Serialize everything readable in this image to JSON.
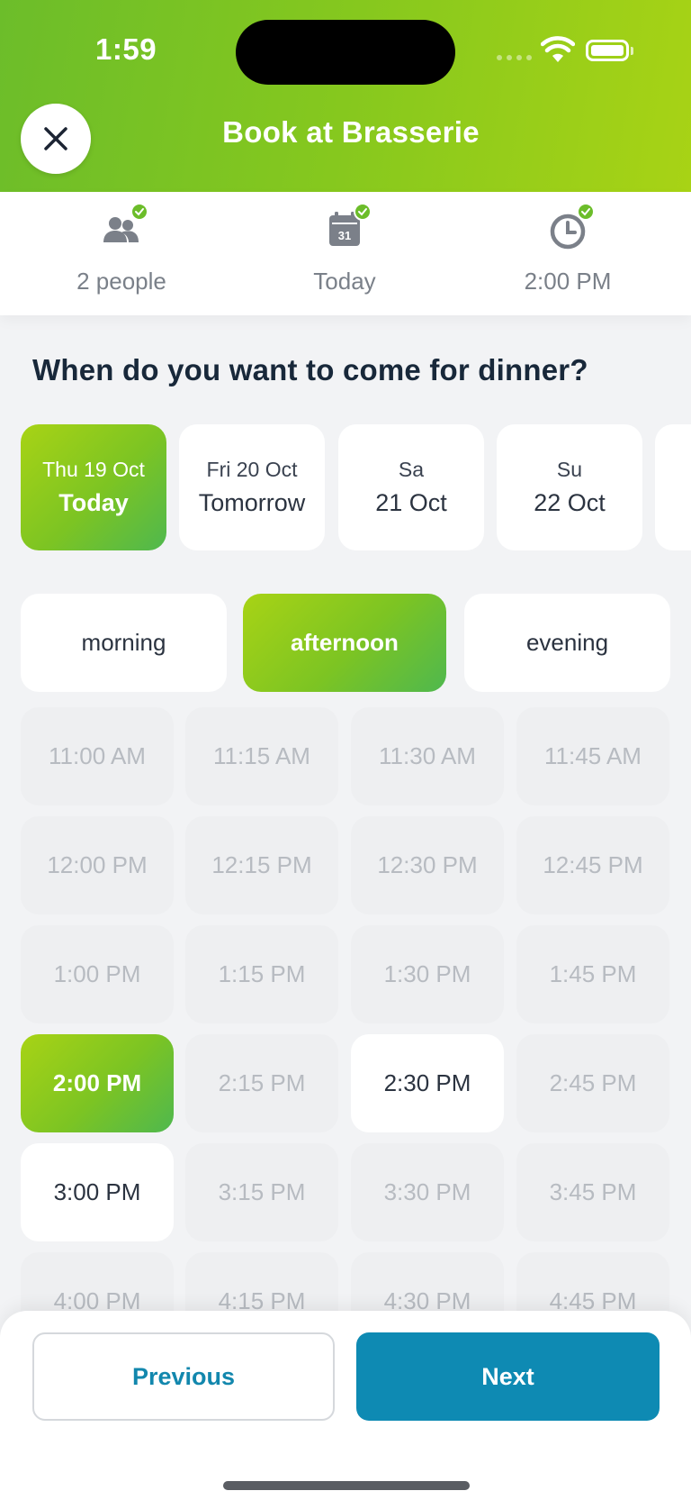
{
  "status_bar": {
    "time": "1:59"
  },
  "header": {
    "title": "Book at Brasserie",
    "close_icon": "close-icon"
  },
  "summary": [
    {
      "label": "2 people",
      "icon": "people-icon",
      "done": true
    },
    {
      "label": "Today",
      "icon": "calendar-icon",
      "calendar_day": "31",
      "done": true
    },
    {
      "label": "2:00 PM",
      "icon": "clock-icon",
      "done": true
    }
  ],
  "question": "When do you want to come for dinner?",
  "dates": [
    {
      "line1": "Thu 19 Oct",
      "line2": "Today",
      "selected": true
    },
    {
      "line1": "Fri 20 Oct",
      "line2": "Tomorrow",
      "selected": false
    },
    {
      "line1": "Sa",
      "line2": "21 Oct",
      "selected": false
    },
    {
      "line1": "Su",
      "line2": "22 Oct",
      "selected": false
    }
  ],
  "periods": [
    {
      "label": "morning",
      "selected": false
    },
    {
      "label": "afternoon",
      "selected": true
    },
    {
      "label": "evening",
      "selected": false
    }
  ],
  "slots": [
    {
      "label": "11:00 AM",
      "state": "disabled"
    },
    {
      "label": "11:15 AM",
      "state": "disabled"
    },
    {
      "label": "11:30 AM",
      "state": "disabled"
    },
    {
      "label": "11:45 AM",
      "state": "disabled"
    },
    {
      "label": "12:00 PM",
      "state": "disabled"
    },
    {
      "label": "12:15 PM",
      "state": "disabled"
    },
    {
      "label": "12:30 PM",
      "state": "disabled"
    },
    {
      "label": "12:45 PM",
      "state": "disabled"
    },
    {
      "label": "1:00 PM",
      "state": "disabled"
    },
    {
      "label": "1:15 PM",
      "state": "disabled"
    },
    {
      "label": "1:30 PM",
      "state": "disabled"
    },
    {
      "label": "1:45 PM",
      "state": "disabled"
    },
    {
      "label": "2:00 PM",
      "state": "selected"
    },
    {
      "label": "2:15 PM",
      "state": "disabled"
    },
    {
      "label": "2:30 PM",
      "state": "available"
    },
    {
      "label": "2:45 PM",
      "state": "disabled"
    },
    {
      "label": "3:00 PM",
      "state": "available"
    },
    {
      "label": "3:15 PM",
      "state": "disabled"
    },
    {
      "label": "3:30 PM",
      "state": "disabled"
    },
    {
      "label": "3:45 PM",
      "state": "disabled"
    },
    {
      "label": "4:00 PM",
      "state": "disabled"
    },
    {
      "label": "4:15 PM",
      "state": "disabled"
    },
    {
      "label": "4:30 PM",
      "state": "disabled"
    },
    {
      "label": "4:45 PM",
      "state": "disabled"
    }
  ],
  "footer": {
    "previous_label": "Previous",
    "next_label": "Next"
  },
  "colors": {
    "brand_green": "#7cc423",
    "accent_blue": "#0e8ab3"
  }
}
